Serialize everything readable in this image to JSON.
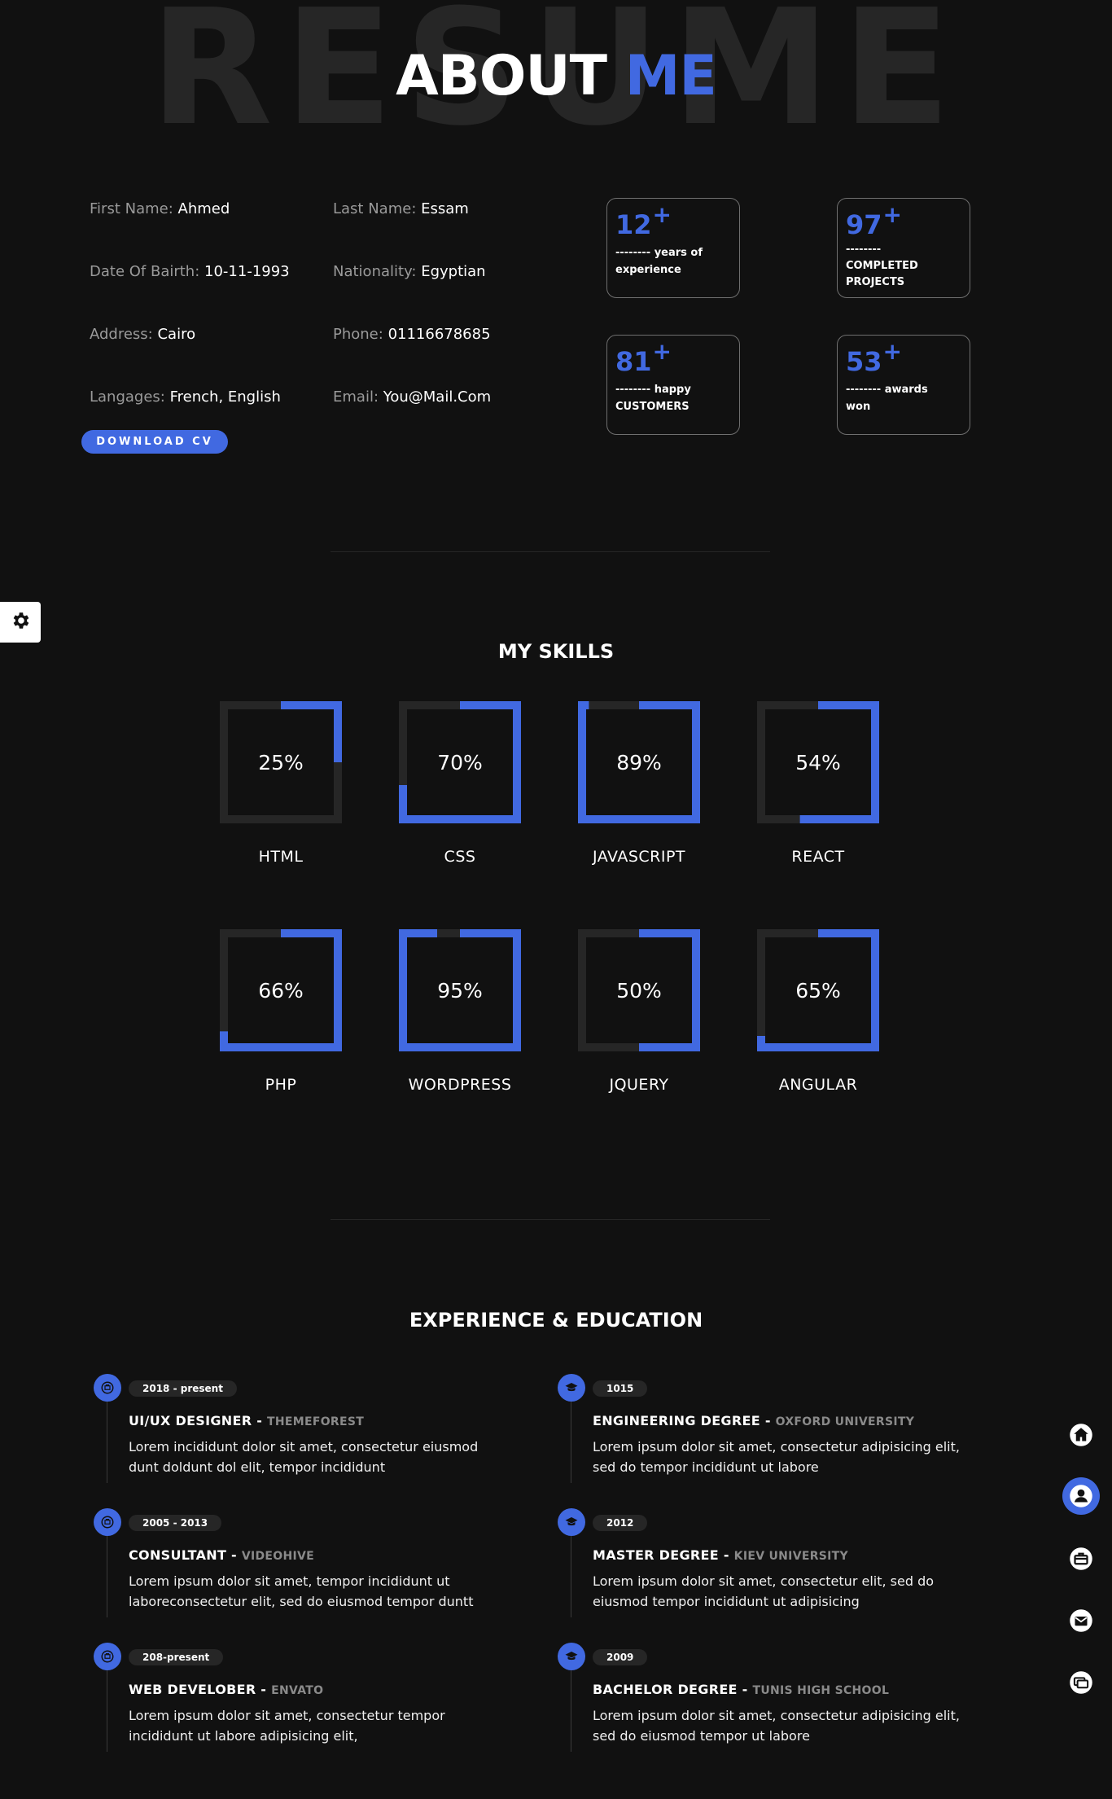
{
  "header": {
    "background_word": "RESUME",
    "title_main": "ABOUT",
    "title_accent": "ME"
  },
  "colors": {
    "accent": "#4169e1",
    "background": "#111111",
    "track": "#262626"
  },
  "personal_info": [
    {
      "label": "First Name:",
      "value": "Ahmed"
    },
    {
      "label": "Last Name:",
      "value": "Essam"
    },
    {
      "label": "Date Of Bairth:",
      "value": "10-11-1993"
    },
    {
      "label": "Nationality:",
      "value": "Egyptian"
    },
    {
      "label": "Address:",
      "value": "Cairo"
    },
    {
      "label": "Phone:",
      "value": "01116678685"
    },
    {
      "label": "Langages:",
      "value": "French, English"
    },
    {
      "label": "Email:",
      "value": "You@Mail.Com"
    }
  ],
  "download_label": "DOWNLOAD CV",
  "stats": [
    {
      "number": "12",
      "plus": "+",
      "text_line1": "-------- years of",
      "text_line2": "experience"
    },
    {
      "number": "97",
      "plus": "+",
      "text_line1": "--------",
      "text_line2": "COMPLETED PROJECTS"
    },
    {
      "number": "81",
      "plus": "+",
      "text_line1": "-------- happy",
      "text_line2": "CUSTOMERS"
    },
    {
      "number": "53",
      "plus": "+",
      "text_line1": "-------- awards",
      "text_line2": "won"
    }
  ],
  "skills_title": "MY SKILLS",
  "skills": [
    {
      "name": "HTML",
      "percent_label": "25%",
      "percent": 25
    },
    {
      "name": "CSS",
      "percent_label": "70%",
      "percent": 70
    },
    {
      "name": "JAVASCRIPT",
      "percent_label": "89%",
      "percent": 89
    },
    {
      "name": "REACT",
      "percent_label": "54%",
      "percent": 54
    },
    {
      "name": "PHP",
      "percent_label": "66%",
      "percent": 66
    },
    {
      "name": "WORDPRESS",
      "percent_label": "95%",
      "percent": 95
    },
    {
      "name": "JQUERY",
      "percent_label": "50%",
      "percent": 50
    },
    {
      "name": "ANGULAR",
      "percent_label": "65%",
      "percent": 65
    }
  ],
  "timeline_title": "EXPERIENCE & EDUCATION",
  "experience": [
    {
      "date": "2018 - present",
      "title": "UI/UX DESIGNER - ",
      "place": "THEMEFOREST",
      "desc": "Lorem incididunt dolor sit amet, consectetur eiusmod dunt doldunt dol elit, tempor incididunt",
      "icon": "briefcase-icon"
    },
    {
      "date": "2005 - 2013",
      "title": "CONSULTANT - ",
      "place": "VIDEOHIVE",
      "desc": "Lorem ipsum dolor sit amet, tempor incididunt ut laboreconsectetur elit, sed do eiusmod tempor duntt",
      "icon": "briefcase-icon"
    },
    {
      "date": "208-present",
      "title": "WEB DEVELOBER - ",
      "place": "ENVATO",
      "desc": "Lorem ipsum dolor sit amet, consectetur tempor incididunt ut labore adipisicing elit,",
      "icon": "briefcase-icon"
    }
  ],
  "education": [
    {
      "date": "1015",
      "title": "ENGINEERING DEGREE - ",
      "place": "OXFORD UNIVERSITY",
      "desc": "Lorem ipsum dolor sit amet, consectetur adipisicing elit, sed do tempor incididunt ut labore",
      "icon": "graduation-cap-icon"
    },
    {
      "date": "2012",
      "title": "MASTER DEGREE - ",
      "place": "KIEV UNIVERSITY",
      "desc": "Lorem ipsum dolor sit amet, consectetur elit, sed do eiusmod tempor incididunt ut adipisicing",
      "icon": "graduation-cap-icon"
    },
    {
      "date": "2009",
      "title": "BACHELOR DEGREE - ",
      "place": "TUNIS HIGH SCHOOL",
      "desc": "Lorem ipsum dolor sit amet, consectetur adipisicing elit, sed do eiusmod tempor ut labore",
      "icon": "graduation-cap-icon"
    }
  ],
  "nav": [
    {
      "icon": "home-icon",
      "active": false
    },
    {
      "icon": "user-icon",
      "active": true
    },
    {
      "icon": "briefcase-icon",
      "active": false
    },
    {
      "icon": "envelope-icon",
      "active": false
    },
    {
      "icon": "chat-icon",
      "active": false
    }
  ],
  "settings_icon": "gear-icon"
}
